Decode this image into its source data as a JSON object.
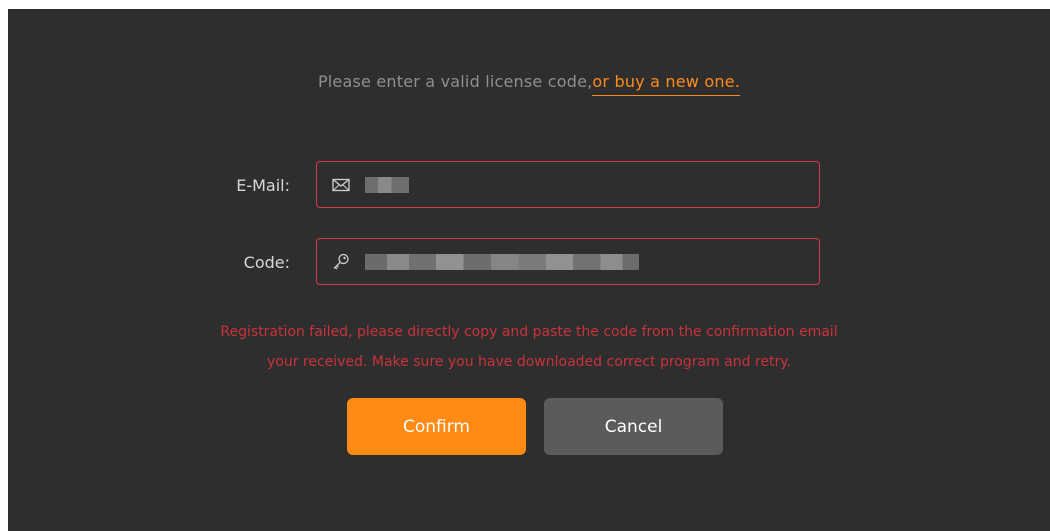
{
  "intro": {
    "text": "Please enter a valid license code,",
    "link": "or buy a new one."
  },
  "email": {
    "label": "E-Mail:",
    "icon": "mail-icon"
  },
  "code": {
    "label": "Code:",
    "icon": "key-icon"
  },
  "error": {
    "line1": "Registration failed, please directly copy and paste the code from the confirmation email",
    "line2": "your received. Make sure you have downloaded correct program and retry."
  },
  "buttons": {
    "confirm": "Confirm",
    "cancel": "Cancel"
  },
  "colors": {
    "background": "#2e2e2e",
    "accent": "#ff8a14",
    "error": "#c8323b",
    "field_border": "#d33a45",
    "cancel_bg": "#5b5b5b"
  }
}
